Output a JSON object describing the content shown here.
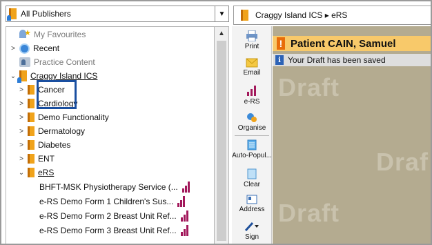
{
  "publisher_select": {
    "value": "All Publishers",
    "dropdown_icon": "chevron-down-icon"
  },
  "tree": {
    "items": [
      {
        "label": "My Favourites",
        "style": "grey",
        "chevron": "",
        "icon": "favourites-icon"
      },
      {
        "label": "Recent",
        "style": "normal",
        "chevron": ">",
        "icon": "clock-icon"
      },
      {
        "label": "Practice Content",
        "style": "grey",
        "chevron": "",
        "icon": "practice-icon"
      },
      {
        "label": "Craggy Island ICS",
        "style": "link",
        "chevron": "v",
        "icon": "book-icon"
      },
      {
        "label": "Cancer",
        "style": "normal",
        "chevron": ">",
        "icon": "book-icon"
      },
      {
        "label": "Cardiology",
        "style": "normal",
        "chevron": ">",
        "icon": "book-icon"
      },
      {
        "label": "Demo Functionality",
        "style": "normal",
        "chevron": ">",
        "icon": "book-icon"
      },
      {
        "label": "Dermatology",
        "style": "normal",
        "chevron": ">",
        "icon": "book-icon"
      },
      {
        "label": "Diabetes",
        "style": "normal",
        "chevron": ">",
        "icon": "book-icon"
      },
      {
        "label": "ENT",
        "style": "normal",
        "chevron": ">",
        "icon": "book-icon"
      },
      {
        "label": "eRS",
        "style": "link",
        "chevron": "v",
        "icon": "book-icon"
      }
    ],
    "forms": [
      {
        "label": "BHFT-MSK Physiotherapy Service (..."
      },
      {
        "label": "e-RS Demo Form 1 Children's Sus..."
      },
      {
        "label": "e-RS Demo Form 2 Breast Unit Ref..."
      },
      {
        "label": "e-RS Demo Form 3 Breast Unit Ref..."
      }
    ]
  },
  "breadcrumb": {
    "path": "Craggy Island ICS ▸ eRS"
  },
  "toolbar": {
    "print": "Print",
    "email": "Email",
    "ers": "e-RS",
    "organise": "Organise",
    "auto_populate": "Auto-Popul...",
    "clear": "Clear",
    "address": "Address",
    "sign": "Sign"
  },
  "content": {
    "patient_banner": "Patient CAIN, Samuel",
    "draft_notice": "Your Draft has been saved",
    "watermark": [
      "Draft",
      "Draf",
      "Draft"
    ]
  },
  "colors": {
    "ers_brand": "#a2185b",
    "highlight_border": "#1a4fa0",
    "draft_bg": "#b4ab90",
    "banner": "#f8c96a"
  }
}
